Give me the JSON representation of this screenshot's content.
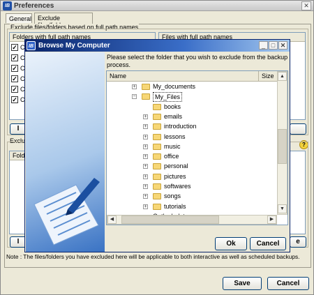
{
  "pref": {
    "title": "Preferences",
    "icon": "IB",
    "close": "✕",
    "tabs": [
      "General",
      "Exclude files/folders"
    ],
    "group1": "Exclude files/folders based on full path names",
    "folders_hdr": "Folders with full path names",
    "files_hdr": "Files with full path names",
    "row_char": "C",
    "exclu": "Exclu",
    "folde": "Folde",
    "btn_stub": "I",
    "btn_stub_right": "e",
    "note": "Note : The files/folders you have excluded here will be applicable to both interactive as well as scheduled backups.",
    "save": "Save",
    "cancel": "Cancel"
  },
  "browse": {
    "title": "Browse My Computer",
    "icon": "IB",
    "instruction": "Please select the folder that you wish to exclude from the backup process.",
    "col_name": "Name",
    "col_size": "Size",
    "items": [
      {
        "label": "My_documents",
        "plus": "+"
      },
      {
        "label": "My_Files",
        "plus": "−"
      },
      {
        "label": "books",
        "plus": ""
      },
      {
        "label": "emails",
        "plus": "+"
      },
      {
        "label": "introduction",
        "plus": "+"
      },
      {
        "label": "lessons",
        "plus": "+"
      },
      {
        "label": "music",
        "plus": "+"
      },
      {
        "label": "office",
        "plus": "+"
      },
      {
        "label": "personal",
        "plus": "+"
      },
      {
        "label": "pictures",
        "plus": "+"
      },
      {
        "label": "softwares",
        "plus": "+"
      },
      {
        "label": "songs",
        "plus": "+"
      },
      {
        "label": "tutorials",
        "plus": "+"
      }
    ],
    "partial_item": "Outlook data",
    "ok": "Ok",
    "cancel": "Cancel"
  },
  "colors": {
    "title_blue": "#0a246a",
    "folder": "#f7d777",
    "panel_border": "#7f9db9"
  }
}
